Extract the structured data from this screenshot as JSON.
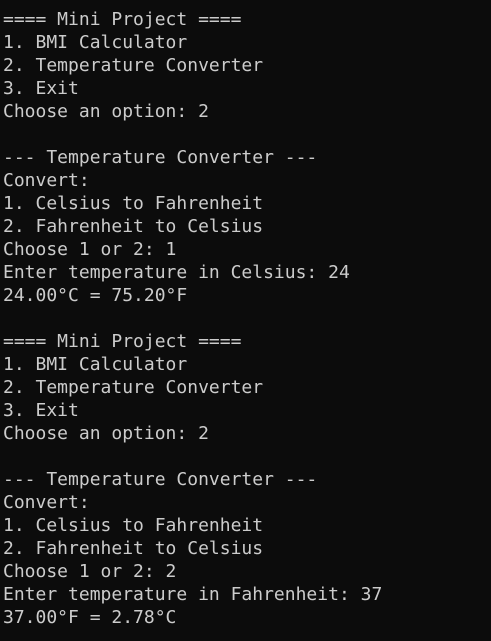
{
  "terminal": {
    "background_color": "#0c0c0c",
    "text_color": "#cccccc",
    "lines": [
      "==== Mini Project ====",
      "1. BMI Calculator",
      "2. Temperature Converter",
      "3. Exit",
      "Choose an option: 2",
      "",
      "--- Temperature Converter ---",
      "Convert:",
      "1. Celsius to Fahrenheit",
      "2. Fahrenheit to Celsius",
      "Choose 1 or 2: 1",
      "Enter temperature in Celsius: 24",
      "24.00°C = 75.20°F",
      "",
      "==== Mini Project ====",
      "1. BMI Calculator",
      "2. Temperature Converter",
      "3. Exit",
      "Choose an option: 2",
      "",
      "--- Temperature Converter ---",
      "Convert:",
      "1. Celsius to Fahrenheit",
      "2. Fahrenheit to Celsius",
      "Choose 1 or 2: 2",
      "Enter temperature in Fahrenheit: 37",
      "37.00°F = 2.78°C"
    ]
  }
}
